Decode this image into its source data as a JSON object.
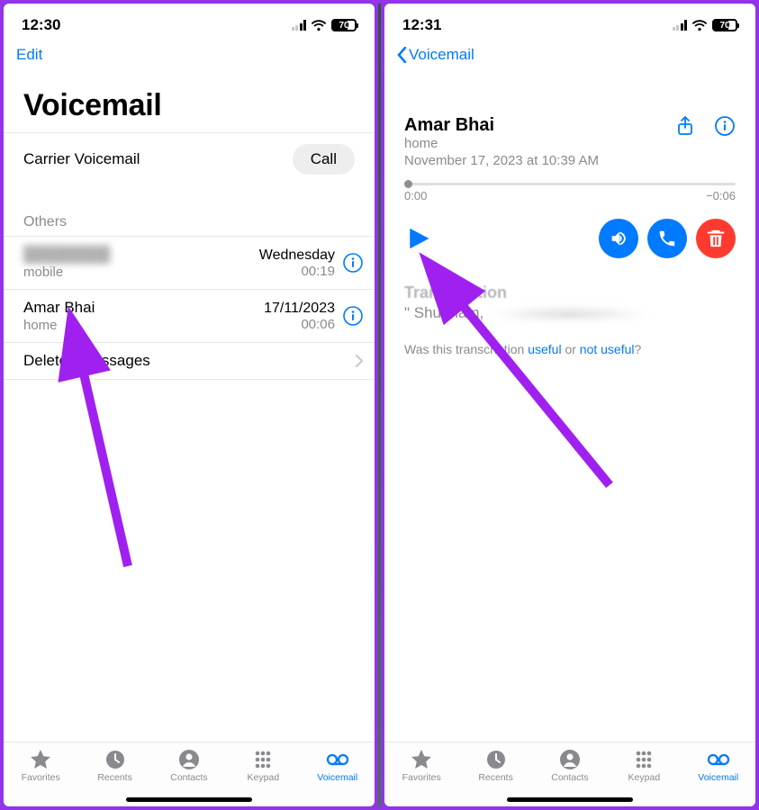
{
  "left": {
    "status": {
      "time": "12:30",
      "battery": "70"
    },
    "nav_edit": "Edit",
    "title": "Voicemail",
    "carrier_label": "Carrier Voicemail",
    "call_button": "Call",
    "section_header": "Others",
    "items": [
      {
        "name": "redacted",
        "sub": "mobile",
        "date": "Wednesday",
        "dur": "00:19"
      },
      {
        "name": "Amar Bhai",
        "sub": "home",
        "date": "17/11/2023",
        "dur": "00:06"
      }
    ],
    "deleted": "Deleted Messages"
  },
  "right": {
    "status": {
      "time": "12:31",
      "battery": "70"
    },
    "nav_back": "Voicemail",
    "detail": {
      "name": "Amar Bhai",
      "label": "home",
      "timestamp": "November 17, 2023 at 10:39 AM",
      "time_start": "0:00",
      "time_remaining": "−0:06"
    },
    "transcription": {
      "title": "Transcription",
      "text_prefix": "\" Shubham,",
      "feedback_q": "Was this transcription ",
      "useful": "useful",
      "or": " or ",
      "not_useful": "not useful",
      "qmark": "?"
    }
  },
  "tabs": {
    "favorites": "Favorites",
    "recents": "Recents",
    "contacts": "Contacts",
    "keypad": "Keypad",
    "voicemail": "Voicemail"
  }
}
